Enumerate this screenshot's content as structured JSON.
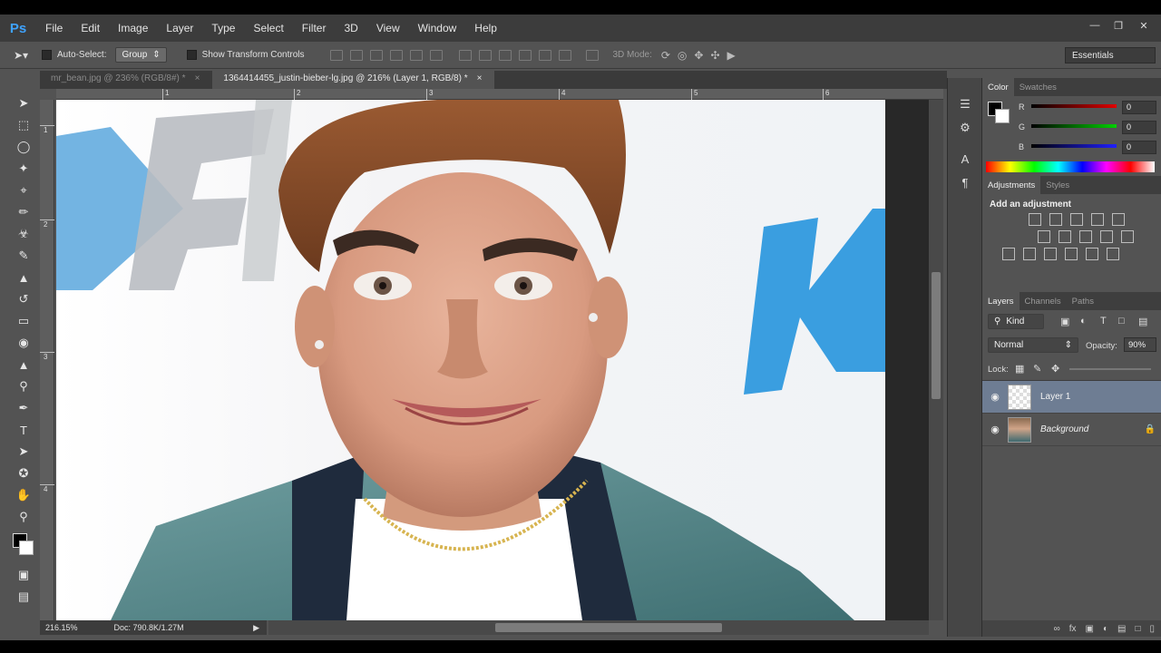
{
  "menubar": {
    "logo": "Ps",
    "items": [
      "File",
      "Edit",
      "Image",
      "Layer",
      "Type",
      "Select",
      "Filter",
      "3D",
      "View",
      "Window",
      "Help"
    ]
  },
  "options": {
    "auto_select_label": "Auto-Select:",
    "auto_select_value": "Group",
    "transform_label": "Show Transform Controls",
    "mode_3d_label": "3D Mode:",
    "workspace": "Essentials"
  },
  "tabs": [
    {
      "label": "mr_bean.jpg @ 236% (RGB/8#) *",
      "active": false
    },
    {
      "label": "1364414455_justin-bieber-lg.jpg @ 216% (Layer 1, RGB/8) *",
      "active": true
    }
  ],
  "ruler": {
    "h": [
      "1",
      "2",
      "3",
      "4",
      "5",
      "6"
    ],
    "v": [
      "1",
      "2",
      "3",
      "4"
    ]
  },
  "status": {
    "zoom": "216.15%",
    "doc": "Doc: 790.8K/1.27M"
  },
  "color_panel": {
    "tabs": [
      "Color",
      "Swatches"
    ],
    "r_label": "R",
    "r_value": "0",
    "g_label": "G",
    "g_value": "0",
    "b_label": "B",
    "b_value": "0"
  },
  "adjustments_panel": {
    "tabs": [
      "Adjustments",
      "Styles"
    ],
    "title": "Add an adjustment"
  },
  "layers_panel": {
    "tabs": [
      "Layers",
      "Channels",
      "Paths"
    ],
    "filter": "Kind",
    "blend_mode": "Normal",
    "opacity_label": "Opacity:",
    "opacity_value": "90%",
    "lock_label": "Lock:",
    "layers": [
      {
        "name": "Layer 1",
        "selected": true
      },
      {
        "name": "Background",
        "selected": false
      }
    ]
  },
  "colors": {
    "accent": "#3fa3ff",
    "selection": "#6e7d93",
    "panel_bg": "#535353"
  }
}
